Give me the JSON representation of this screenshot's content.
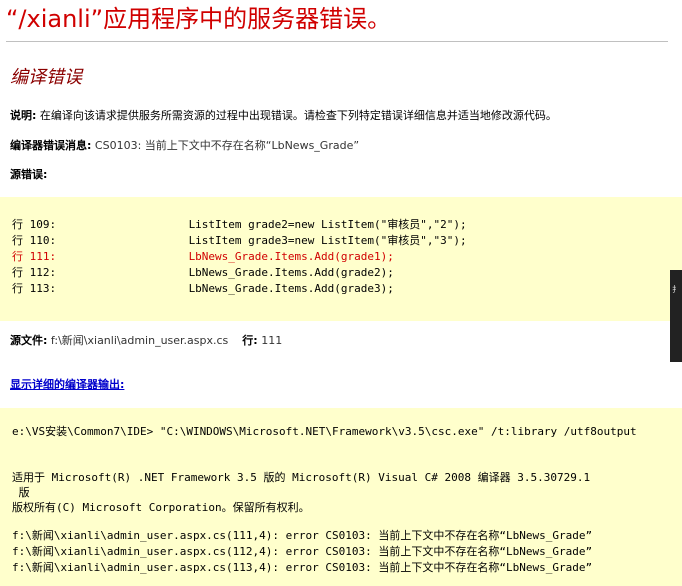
{
  "page": {
    "title": "“/xianli”应用程序中的服务器错误。",
    "section_title": "编译错误"
  },
  "description": {
    "label": "说明:",
    "text": "在编译向该请求提供服务所需资源的过程中出现错误。请检查下列特定错误详细信息并适当地修改源代码。"
  },
  "compiler_message": {
    "label": "编译器错误消息:",
    "text": "CS0103: 当前上下文中不存在名称“LbNews_Grade”"
  },
  "source_error": {
    "label": "源错误:",
    "lines": [
      {
        "text": "行 109:                    ListItem grade2=new ListItem(\"审核员\",\"2\");",
        "error": false
      },
      {
        "text": "行 110:                    ListItem grade3=new ListItem(\"审核员\",\"3\");",
        "error": false
      },
      {
        "text": "行 111:                    LbNews_Grade.Items.Add(grade1);",
        "error": true
      },
      {
        "text": "行 112:                    LbNews_Grade.Items.Add(grade2);",
        "error": false
      },
      {
        "text": "行 113:                    LbNews_Grade.Items.Add(grade3);",
        "error": false
      }
    ]
  },
  "source_file": {
    "label": "源文件:",
    "path": "f:\\新闻\\xianli\\admin_user.aspx.cs",
    "line_label": "行:",
    "line_number": "111"
  },
  "compiler_output": {
    "link_label": "显示详细的编译器输出:",
    "lines": [
      "e:\\VS安装\\Common7\\IDE> \"C:\\WINDOWS\\Microsoft.NET\\Framework\\v3.5\\csc.exe\" /t:library /utf8output",
      "适用于 Microsoft(R) .NET Framework 3.5 版的 Microsoft(R) Visual C# 2008 编译器 3.5.30729.1",
      " 版",
      "版权所有(C) Microsoft Corporation。保留所有权利。",
      "f:\\新闻\\xianli\\admin_user.aspx.cs(111,4): error CS0103: 当前上下文中不存在名称“LbNews_Grade”",
      "f:\\新闻\\xianli\\admin_user.aspx.cs(112,4): error CS0103: 当前上下文中不存在名称“LbNews_Grade”",
      "f:\\新闻\\xianli\\admin_user.aspx.cs(113,4): error CS0103: 当前上下文中不存在名称“LbNews_Grade”"
    ]
  },
  "side_widget": {
    "glyph": "扌"
  },
  "colors": {
    "title": "#d00000",
    "section_title": "#8b0000",
    "code_background": "#ffffcc",
    "error_line": "#d00000",
    "link": "#0000cc"
  }
}
